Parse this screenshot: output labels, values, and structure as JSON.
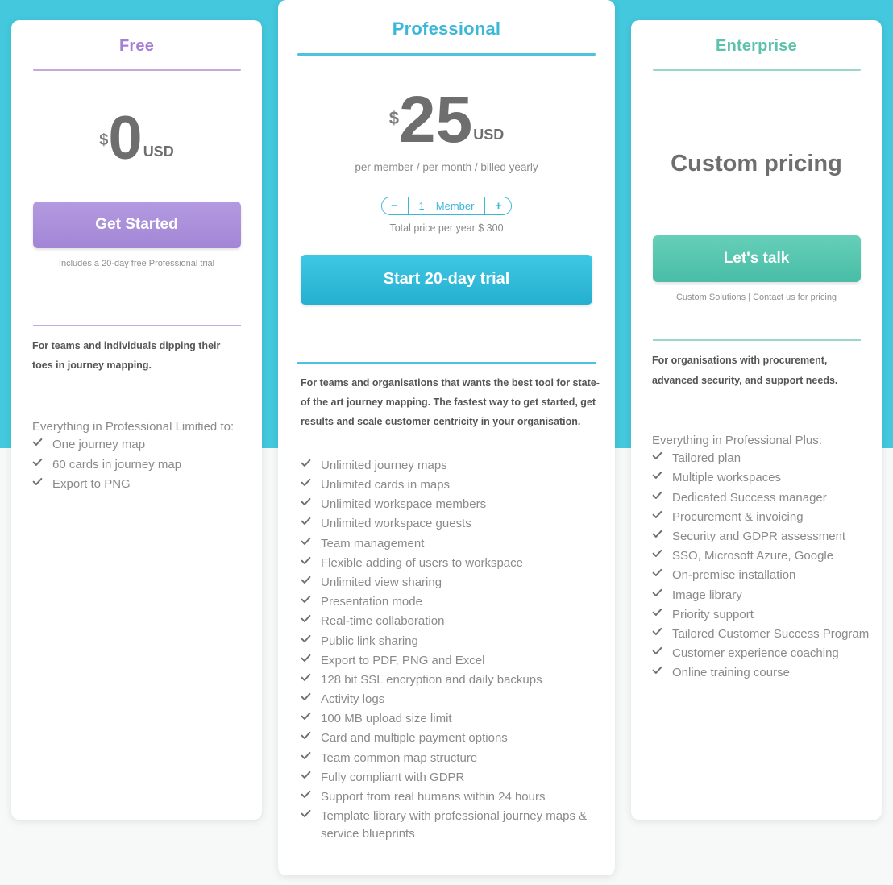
{
  "theme": {
    "background_band": "#44c8dd",
    "page_background": "#f7f9f9",
    "free_accent": "#a57fd4",
    "pro_accent": "#3cb7d8",
    "enterprise_accent": "#5cc2ad",
    "price_text": "#6e6e6e",
    "feature_text": "#8a8a8a"
  },
  "plans": {
    "free": {
      "title": "Free",
      "price": {
        "currency_symbol": "$",
        "amount": "0",
        "unit": "USD"
      },
      "cta_label": "Get Started",
      "cta_note": "Includes a 20-day free Professional trial",
      "description": "For teams and individuals dipping their toes in journey mapping.",
      "features_intro": "Everything in Professional Limitied to:",
      "features": [
        "One journey map",
        "60 cards in journey map",
        "Export to PNG"
      ]
    },
    "professional": {
      "title": "Professional",
      "price": {
        "currency_symbol": "$",
        "amount": "25",
        "unit": "USD"
      },
      "price_sub": "per member / per month / billed yearly",
      "stepper": {
        "decrement_label": "−",
        "increment_label": "+",
        "count": "1",
        "unit_label": "Member"
      },
      "total_price": "Total price per year $ 300",
      "cta_label": "Start 20-day trial",
      "description": "For teams and organisations that wants the best tool for state-of the art journey mapping. The fastest way to get started, get results and scale customer centricity in your organisation.",
      "features_intro": "",
      "features": [
        "Unlimited journey maps",
        "Unlimited cards in maps",
        "Unlimited workspace members",
        "Unlimited workspace guests",
        "Team management",
        "Flexible adding of users to workspace",
        "Unlimited view sharing",
        "Presentation mode",
        "Real-time collaboration",
        "Public link sharing",
        "Export to PDF, PNG and Excel",
        "128 bit SSL encryption and daily backups",
        "Activity logs",
        "100 MB upload size limit",
        "Card and multiple payment options",
        "Team common map structure",
        "Fully compliant with GDPR",
        "Support from real humans within 24 hours",
        "Template library with professional journey maps & service blueprints"
      ]
    },
    "enterprise": {
      "title": "Enterprise",
      "price_custom": "Custom pricing",
      "cta_label": "Let's talk",
      "cta_note": "Custom Solutions | Contact us for pricing",
      "description": "For organisations with procurement, advanced security, and support needs.",
      "features_intro": "Everything in Professional Plus:",
      "features": [
        "Tailored plan",
        "Multiple workspaces",
        "Dedicated Success manager",
        "Procurement & invoicing",
        "Security and GDPR assessment",
        "SSO, Microsoft Azure, Google",
        "On-premise installation",
        "Image library",
        "Priority support",
        "Tailored Customer Success Program",
        "Customer experience coaching",
        "Online training course"
      ]
    }
  }
}
